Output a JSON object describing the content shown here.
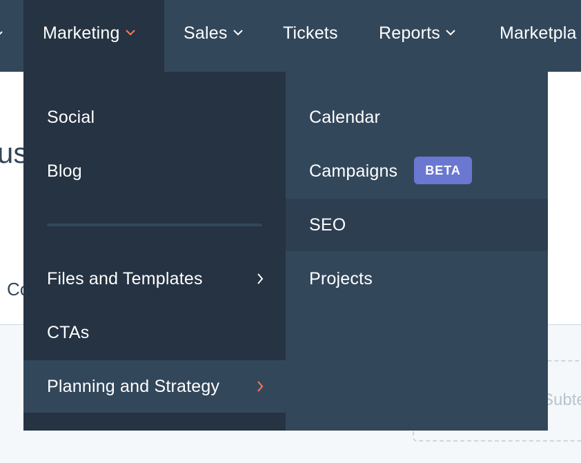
{
  "topnav": {
    "items": [
      {
        "label": "Marketing",
        "has_dropdown": true,
        "active": true
      },
      {
        "label": "Sales",
        "has_dropdown": true
      },
      {
        "label": "Tickets",
        "has_dropdown": false
      },
      {
        "label": "Reports",
        "has_dropdown": true
      },
      {
        "label": "Marketpla",
        "has_dropdown": false
      }
    ]
  },
  "page": {
    "heading_fragment": "us",
    "text_fragment": "Co",
    "card_text_fragment": "Subte"
  },
  "marketing_menu": {
    "items": [
      {
        "label": "Social"
      },
      {
        "label": "Blog"
      },
      {
        "label": "Files and Templates",
        "icon": "chevron-right-icon"
      },
      {
        "label": "CTAs"
      },
      {
        "label": "Planning and Strategy",
        "icon": "chevron-right-icon",
        "highlighted": true
      }
    ]
  },
  "submenu": {
    "items": [
      {
        "label": "Calendar"
      },
      {
        "label": "Campaigns",
        "badge": "BETA"
      },
      {
        "label": "SEO",
        "highlighted": true
      },
      {
        "label": "Projects"
      }
    ]
  },
  "colors": {
    "nav_bg": "#33475b",
    "nav_active_bg": "#253342",
    "accent_chevron": "#ff7a59",
    "beta_badge": "#6a78d1"
  }
}
